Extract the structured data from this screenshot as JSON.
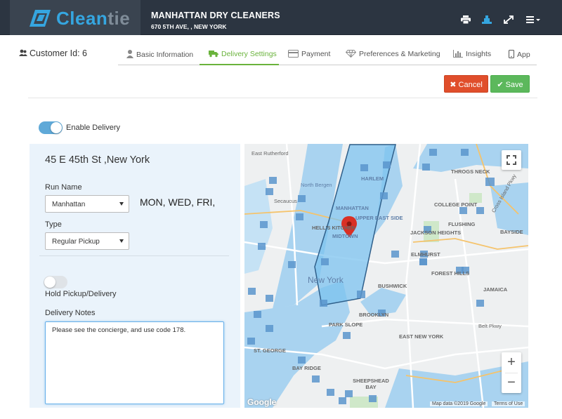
{
  "brand": {
    "logo_part1": "Clean",
    "logo_part2": "tie",
    "accent": "#35a6e0"
  },
  "business": {
    "name": "MANHATTAN DRY CLEANERS",
    "address": "670 5TH AVE, , NEW YORK"
  },
  "header_icons": [
    "print-icon",
    "route-icon",
    "expand-icon",
    "menu-icon"
  ],
  "customer": {
    "label": "Customer Id: 6"
  },
  "tabs": [
    {
      "label": "Basic Information",
      "icon": "user-icon"
    },
    {
      "label": "Delivery Settings",
      "icon": "truck-icon",
      "active": true
    },
    {
      "label": "Payment",
      "icon": "card-icon"
    },
    {
      "label": "Preferences & Marketing",
      "icon": "diamond-icon"
    },
    {
      "label": "Insights",
      "icon": "bar-chart-icon"
    },
    {
      "label": "App",
      "icon": "phone-icon"
    }
  ],
  "actions": {
    "cancel": "Cancel",
    "save": "Save"
  },
  "delivery": {
    "enable_label": "Enable Delivery",
    "enabled": true,
    "address": "45 E 45th St ,New York",
    "run_name_label": "Run Name",
    "run_name_value": "Manhattan",
    "days": "MON, WED, FRI,",
    "type_label": "Type",
    "type_value": "Regular Pickup",
    "hold_label": "Hold Pickup/Delivery",
    "hold": false,
    "notes_label": "Delivery Notes",
    "notes_value": "Please see the concierge, and use code 178."
  },
  "map": {
    "labels": {
      "east_rutherford": "East Rutherford",
      "north_bergen": "North Bergen",
      "secaucus": "Secaucus",
      "harlem": "HARLEM",
      "manhattan": "MANHATTAN",
      "upper_east_side": "UPPER EAST SIDE",
      "hells_kitchen": "HELL'S KITCHEN",
      "midtown": "MIDTOWN",
      "new_york": "New York",
      "throgs_neck": "THROGS NECK",
      "college_point": "COLLEGE POINT",
      "bayside": "BAYSIDE",
      "flushing": "FLUSHING",
      "jackson_heights": "JACKSON HEIGHTS",
      "elmhurst": "ELMHURST",
      "forest_hills": "FOREST HILLS",
      "jamaica": "JAMAICA",
      "bushwick": "BUSHWICK",
      "brooklyn": "BROOKLYN",
      "park_slope": "PARK SLOPE",
      "east_new_york": "EAST NEW YORK",
      "st_george": "ST. GEORGE",
      "bay_ridge": "BAY RIDGE",
      "sheepshead_bay": "SHEEPSHEAD BAY",
      "belt_pkwy": "Belt Pkwy",
      "cross_island_pkwy": "Cross Island Pkwy"
    },
    "google": "Google",
    "attribution": "Map data ©2019 Google",
    "terms": "Terms of Use",
    "zoom_in": "+",
    "zoom_out": "−",
    "colors": {
      "zone_fill": "#7cc3ef",
      "zone_stroke": "#2f5f8a",
      "marker": "#d93025"
    }
  },
  "colors": {
    "active_tab": "#6ab33c",
    "cancel": "#e04e2b",
    "save": "#5cb85c",
    "toggle_on": "#5fa9d8",
    "panel": "#eaf3fb"
  }
}
